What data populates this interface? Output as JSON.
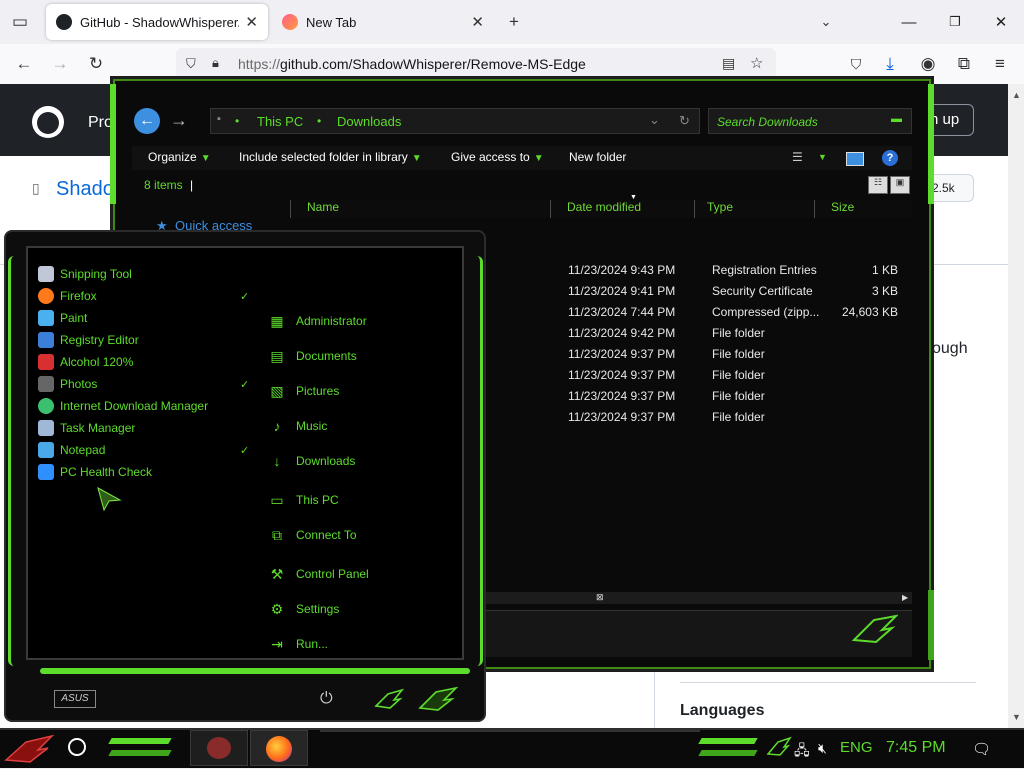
{
  "browser": {
    "tabs": [
      {
        "title": "GitHub - ShadowWhisperer/Re",
        "active": true
      },
      {
        "title": "New Tab",
        "active": false
      }
    ],
    "new_tab_glyph": "+",
    "url_proto": "https://",
    "url_rest": "github.com/ShadowWhisperer/Remove-MS-Edge"
  },
  "github": {
    "header_partial": "Pro",
    "signup_partial": "n up",
    "repo_partial": "Shado",
    "star_count": "2.5k",
    "text_partial": "ough",
    "languages_heading": "Languages"
  },
  "explorer": {
    "breadcrumb": [
      "This PC",
      "Downloads"
    ],
    "search_placeholder": "Search Downloads",
    "toolbar": {
      "organize": "Organize",
      "include": "Include selected folder in library",
      "share": "Give access to",
      "new_folder": "New folder",
      "help": "?"
    },
    "item_count": "8 items",
    "columns": {
      "name": "Name",
      "date": "Date modified",
      "type": "Type",
      "size": "Size"
    },
    "nav": {
      "quick_access": "Quick access"
    },
    "files": [
      {
        "date": "11/23/2024 9:43 PM",
        "type": "Registration Entries",
        "size": "1 KB"
      },
      {
        "date": "11/23/2024 9:41 PM",
        "type": "Security Certificate",
        "size": "3 KB"
      },
      {
        "date": "11/23/2024 7:44 PM",
        "type": "Compressed (zipp...",
        "size": "24,603 KB"
      },
      {
        "date": "11/23/2024 9:42 PM",
        "type": "File folder",
        "size": ""
      },
      {
        "date": "11/23/2024 9:37 PM",
        "type": "File folder",
        "size": ""
      },
      {
        "date": "11/23/2024 9:37 PM",
        "type": "File folder",
        "size": ""
      },
      {
        "date": "11/23/2024 9:37 PM",
        "type": "File folder",
        "size": ""
      },
      {
        "date": "11/23/2024 9:37 PM",
        "type": "File folder",
        "size": ""
      }
    ]
  },
  "start_menu": {
    "programs": [
      {
        "label": "Snipping Tool",
        "color": "#c0c8d8",
        "pinned": false
      },
      {
        "label": "Firefox",
        "color": "#ff7a1a",
        "pinned": true
      },
      {
        "label": "Paint",
        "color": "#4ab0f0",
        "pinned": false
      },
      {
        "label": "Registry Editor",
        "color": "#3b7fd8",
        "pinned": false
      },
      {
        "label": "Alcohol 120%",
        "color": "#d83030",
        "pinned": false
      },
      {
        "label": "Photos",
        "color": "#666666",
        "pinned": true
      },
      {
        "label": "Internet Download Manager",
        "color": "#3cc070",
        "pinned": false
      },
      {
        "label": "Task Manager",
        "color": "#9fb8d8",
        "pinned": false
      },
      {
        "label": "Notepad",
        "color": "#4aa8e8",
        "pinned": true
      },
      {
        "label": "PC Health Check",
        "color": "#2f8fff",
        "pinned": false
      }
    ],
    "places": [
      {
        "label": "Administrator",
        "icon": "user-icon"
      },
      {
        "label": "Documents",
        "icon": "document-icon"
      },
      {
        "label": "Pictures",
        "icon": "picture-icon"
      },
      {
        "label": "Music",
        "icon": "music-icon"
      },
      {
        "label": "Downloads",
        "icon": "download-icon"
      },
      {
        "label": "This PC",
        "icon": "computer-icon"
      },
      {
        "label": "Connect To",
        "icon": "network-icon"
      },
      {
        "label": "Control Panel",
        "icon": "wrench-icon"
      },
      {
        "label": "Settings",
        "icon": "gear-icon"
      },
      {
        "label": "Run...",
        "icon": "run-icon"
      }
    ],
    "pin_glyph": "✓",
    "logo_text": "ASUS"
  },
  "taskbar": {
    "lang": "ENG",
    "time": "7:45 PM"
  },
  "colors": {
    "accent": "#5ddc2c",
    "github_dark": "#1f2328",
    "explorer_bg": "#0a0a0a"
  }
}
